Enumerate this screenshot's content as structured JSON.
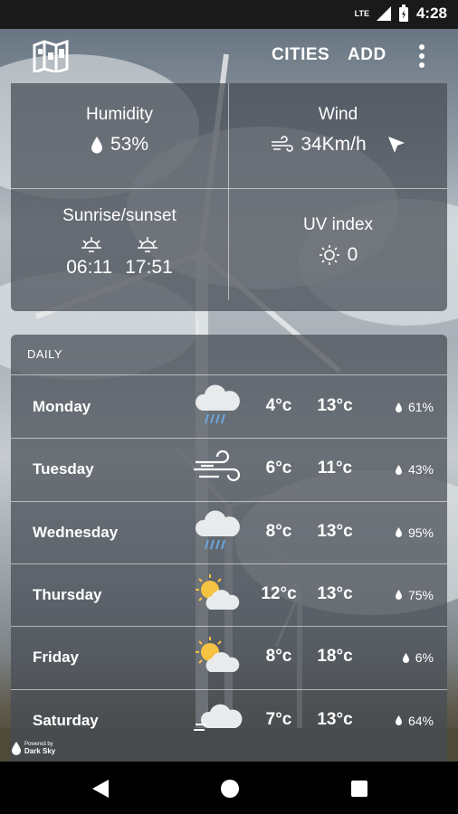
{
  "status": {
    "network": "LTE",
    "time": "4:28"
  },
  "toolbar": {
    "cities_label": "CITIES",
    "add_label": "ADD"
  },
  "details": {
    "humidity": {
      "title": "Humidity",
      "value": "53%"
    },
    "wind": {
      "title": "Wind",
      "value": "34Km/h"
    },
    "sun": {
      "title": "Sunrise/sunset",
      "sunrise": "06:11",
      "sunset": "17:51"
    },
    "uv": {
      "title": "UV index",
      "value": "0"
    }
  },
  "daily": {
    "title": "DAILY",
    "days": [
      {
        "day": "Monday",
        "icon": "rain-cloud-icon",
        "min": "4°c",
        "max": "13°c",
        "precip": "61%"
      },
      {
        "day": "Tuesday",
        "icon": "wind-icon",
        "min": "6°c",
        "max": "11°c",
        "precip": "43%"
      },
      {
        "day": "Wednesday",
        "icon": "rain-cloud-icon",
        "min": "8°c",
        "max": "13°c",
        "precip": "95%"
      },
      {
        "day": "Thursday",
        "icon": "partly-cloudy-icon",
        "min": "12°c",
        "max": "13°c",
        "precip": "75%"
      },
      {
        "day": "Friday",
        "icon": "partly-cloudy-icon",
        "min": "8°c",
        "max": "18°c",
        "precip": "6%"
      },
      {
        "day": "Saturday",
        "icon": "fog-cloud-icon",
        "min": "7°c",
        "max": "13°c",
        "precip": "64%"
      }
    ]
  },
  "attribution": {
    "line1": "Powered by",
    "line2": "Dark Sky"
  }
}
